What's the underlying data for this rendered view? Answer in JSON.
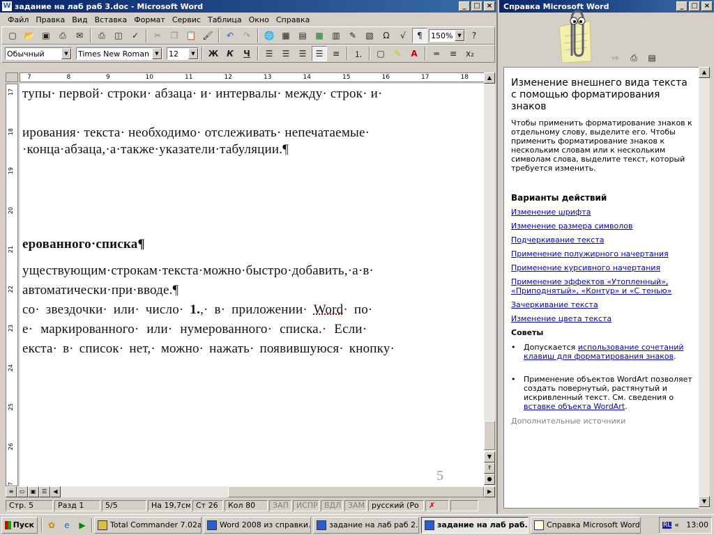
{
  "word": {
    "title": "задание на  лаб раб 3.doc - Microsoft Word",
    "menu": [
      "Файл",
      "Правка",
      "Вид",
      "Вставка",
      "Формат",
      "Сервис",
      "Таблица",
      "Окно",
      "Справка"
    ],
    "zoom": "150%",
    "style": "Обычный",
    "font": "Times New Roman",
    "size": "12",
    "bold": "Ж",
    "italic": "К",
    "underline": "Ч",
    "ruler_numbers": [
      "7",
      "8",
      "9",
      "10",
      "11",
      "12",
      "13",
      "14",
      "15",
      "16",
      "17",
      "18"
    ],
    "ruler_left_numbers": [
      "17",
      "18",
      "19",
      "20",
      "21",
      "22",
      "23",
      "24",
      "25",
      "26",
      "27"
    ],
    "lines": [
      "тупы· первой· строки· абзаца· и· интервалы· между· строк· и·",
      "ирования· текста· необходимо· отслеживать· непечатаемые·",
      "·конца·абзаца,·а·также·указатели·табуляции.¶",
      "ерованного·списка¶",
      "уществующим·строкам·текста·можно·быстро·добавить,·а·в·",
      "автоматически·при·вводе.¶",
      "со· звездочки· или· число· ",
      "1.",
      ",· в· приложении· ",
      "Word",
      "· по·",
      "е· маркированного· или· нумерованного· списка.· Если·",
      "екста· в· список· нет,· можно· нажать· появившуюся· кнопку·"
    ],
    "page_number": "5",
    "status": {
      "page": "Стр.  5",
      "section": "Разд  1",
      "pages": "5/5",
      "at": "На 19,7см",
      "line": "Ст  26",
      "col": "Кол  80",
      "rec": "ЗАП",
      "trk": "ИСПР",
      "ext": "ВДЛ",
      "ovr": "ЗАМ",
      "lang": "русский (Ро"
    }
  },
  "help": {
    "title": "Справка Microsoft Word",
    "heading": "Изменение внешнего вида текста с помощью форматирования знаков",
    "intro": "Чтобы применить форматирование знаков к отдельному слову, выделите его. Чтобы применить форматирование знаков к нескольким словам или к нескольким символам слова, выделите текст, который требуется изменить.",
    "actions_heading": "Варианты действий",
    "links": [
      "Изменение шрифта",
      "Изменение размера символов",
      "Подчеркивание текста",
      "Применение полужирного начертания",
      "Применение курсивного начертания",
      "Применение эффектов «Утопленный», «Приподнятый», «Контур» и «С тенью»",
      "Зачеркивание текста",
      "Изменение цвета текста"
    ],
    "tips_heading": "Советы",
    "tip1_prefix": "Допускается ",
    "tip1_link": "использование сочетаний клавиш для форматирования знаков",
    "tip1_suffix": ".",
    "tip2_prefix": "Применение объектов WordArt позволяет создать повернутый, растянутый и искривленный текст. См. сведения о ",
    "tip2_link": "вставке объекта WordArt",
    "tip2_suffix": ".",
    "more": "Дополнительные источники"
  },
  "taskbar": {
    "start": "Пуск",
    "tasks": [
      "Total Commander 7.02a...",
      "Word 2008 из справки....",
      "задание на  лаб раб 2....",
      "задание на  лаб раб...",
      "Справка Microsoft Word"
    ],
    "lang": "RL",
    "clock": "13:00"
  },
  "colors": {
    "title_start": "#0a246a",
    "title_end": "#3a6ea5",
    "link": "#0000cc",
    "face": "#d4d0c8"
  }
}
